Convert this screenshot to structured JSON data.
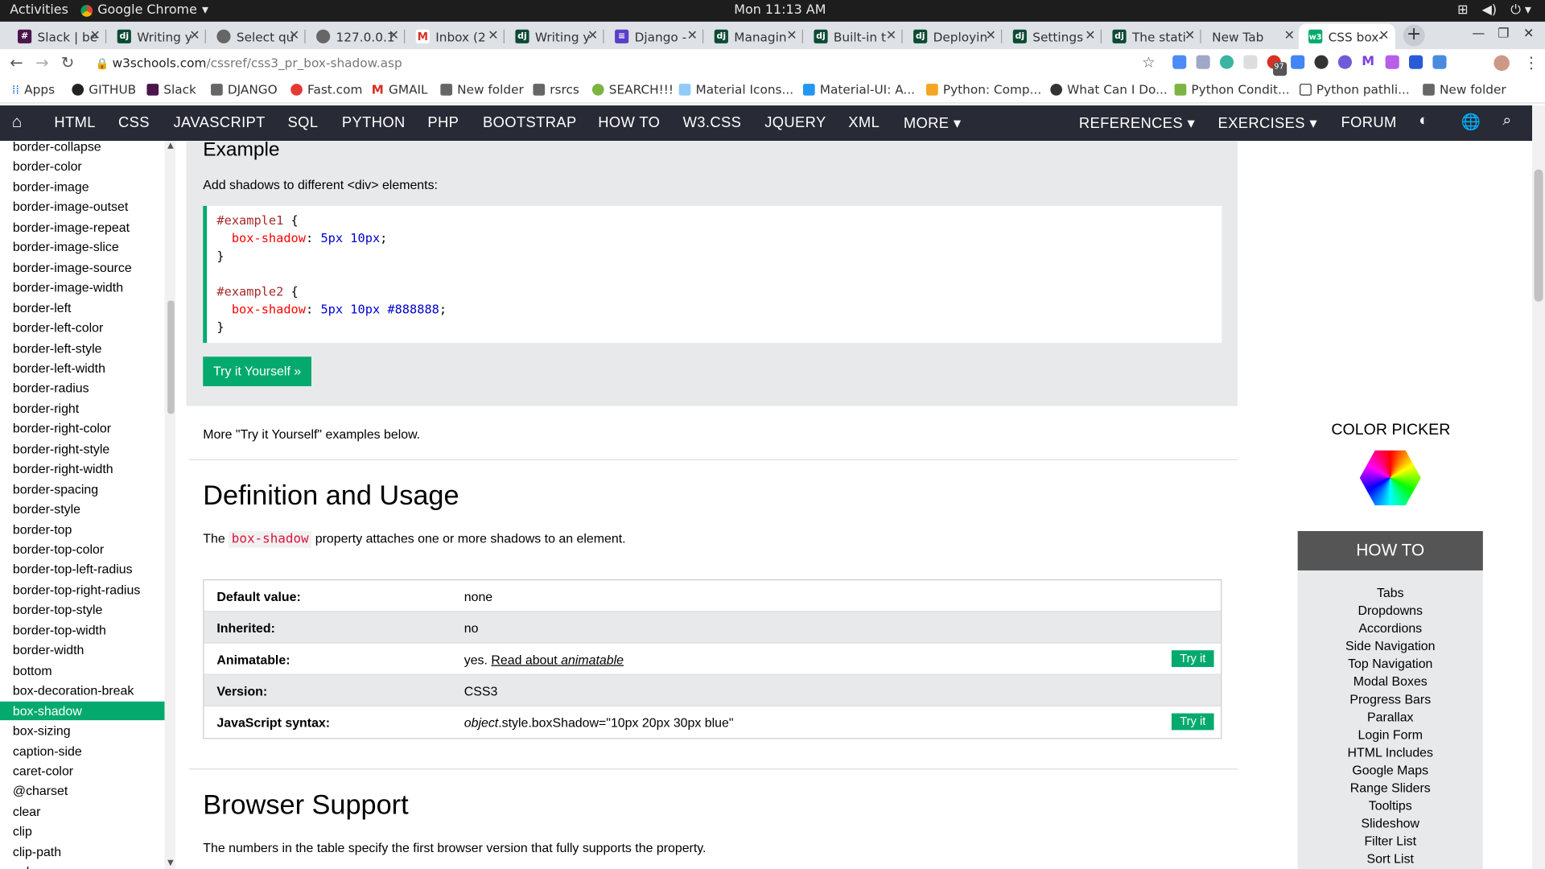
{
  "os": {
    "activities": "Activities",
    "app_name": "Google Chrome",
    "clock": "Mon 11:13 AM"
  },
  "tabs": [
    "Slack | be",
    "Writing y",
    "Select qu",
    "127.0.0.1",
    "Inbox (2",
    "Writing y",
    "Django -",
    "Managin",
    "Built-in t",
    "Deployin",
    "Settings",
    "The stati",
    "New Tab",
    "CSS box-"
  ],
  "address": {
    "host": "w3schools.com",
    "path": "/cssref/css3_pr_box-shadow.asp",
    "ext_badge": "97"
  },
  "bookmarks": [
    "Apps",
    "GITHUB",
    "Slack",
    "DJANGO",
    "Fast.com",
    "GMAIL",
    "New folder",
    "rsrcs",
    "SEARCH!!!",
    "Material Icons...",
    "Material-UI: A...",
    "Python: Comp...",
    "What Can I Do...",
    "Python Condit...",
    "Python pathli...",
    "New folder"
  ],
  "topnav": {
    "items": [
      "HTML",
      "CSS",
      "JAVASCRIPT",
      "SQL",
      "PYTHON",
      "PHP",
      "BOOTSTRAP",
      "HOW TO",
      "W3.CSS",
      "JQUERY",
      "XML",
      "MORE ▾"
    ],
    "right": [
      "REFERENCES ▾",
      "EXERCISES ▾",
      "FORUM"
    ]
  },
  "sidebar": {
    "items": [
      "border-collapse",
      "border-color",
      "border-image",
      "border-image-outset",
      "border-image-repeat",
      "border-image-slice",
      "border-image-source",
      "border-image-width",
      "border-left",
      "border-left-color",
      "border-left-style",
      "border-left-width",
      "border-radius",
      "border-right",
      "border-right-color",
      "border-right-style",
      "border-right-width",
      "border-spacing",
      "border-style",
      "border-top",
      "border-top-color",
      "border-top-left-radius",
      "border-top-right-radius",
      "border-top-style",
      "border-top-width",
      "border-width",
      "bottom",
      "box-decoration-break",
      "box-shadow",
      "box-sizing",
      "caption-side",
      "caret-color",
      "@charset",
      "clear",
      "clip",
      "clip-path",
      "color"
    ],
    "selected": "box-shadow"
  },
  "example": {
    "title": "Example",
    "intro": "Add shadows to different <div> elements:",
    "code1_sel": "#example1",
    "code1_prop": "box-shadow",
    "code1_val": "5px 10px",
    "code2_sel": "#example2",
    "code2_prop": "box-shadow",
    "code2_val": "5px 10px #888888",
    "button": "Try it Yourself »"
  },
  "more_text": "More \"Try it Yourself\" examples below.",
  "definition": {
    "title": "Definition and Usage",
    "pre": "The",
    "keyword": "box-shadow",
    "post": "property attaches one or more shadows to an element."
  },
  "table": {
    "rows": [
      {
        "key": "Default value:",
        "value": "none"
      },
      {
        "key": "Inherited:",
        "value": "no"
      },
      {
        "key": "Animatable:",
        "value": "yes.",
        "link": "Read about",
        "link_em": "animatable",
        "button": "Try it"
      },
      {
        "key": "Version:",
        "value": "CSS3"
      },
      {
        "key": "JavaScript syntax:",
        "value_em": "object",
        "value": ".style.boxShadow=\"10px 20px 30px blue\"",
        "button": "Try it"
      }
    ]
  },
  "support": {
    "title": "Browser Support",
    "text": "The numbers in the table specify the first browser version that fully supports the property."
  },
  "right": {
    "color_picker": "COLOR PICKER",
    "howto_title": "HOW TO",
    "howto_items": [
      "Tabs",
      "Dropdowns",
      "Accordions",
      "Side Navigation",
      "Top Navigation",
      "Modal Boxes",
      "Progress Bars",
      "Parallax",
      "Login Form",
      "HTML Includes",
      "Google Maps",
      "Range Sliders",
      "Tooltips",
      "Slideshow",
      "Filter List",
      "Sort List"
    ]
  },
  "colors": {
    "accent": "#04aa6d",
    "nav": "#282a35",
    "panel": "#e7e9eb"
  }
}
